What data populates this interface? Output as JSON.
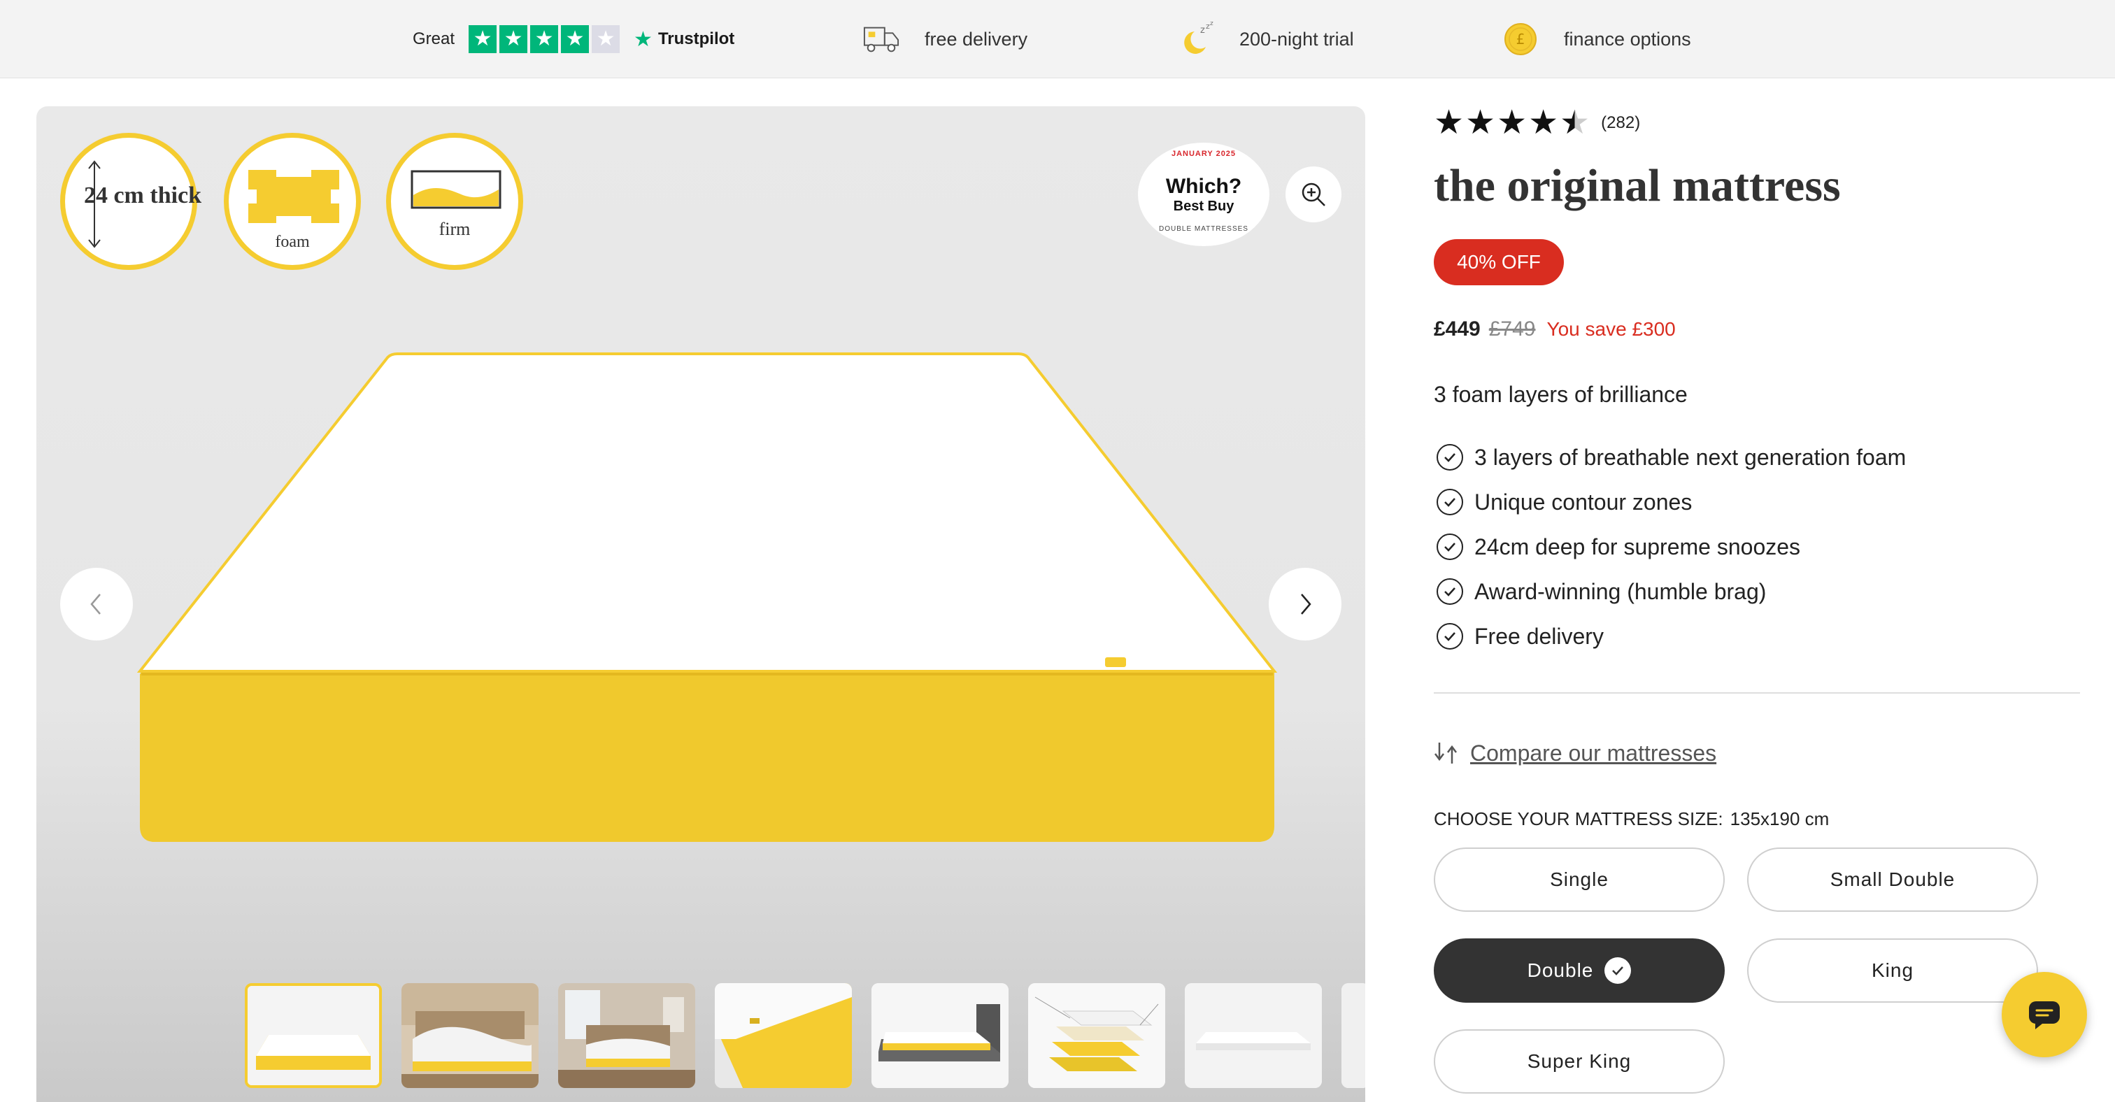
{
  "topbar": {
    "trustpilot": {
      "rating_word": "Great",
      "stars_filled": 4,
      "stars_total": 5,
      "brand": "Trustpilot"
    },
    "usps": [
      {
        "icon": "delivery-truck-icon",
        "label": "free delivery"
      },
      {
        "icon": "moon-sleep-icon",
        "label": "200-night trial"
      },
      {
        "icon": "pound-coin-icon",
        "label": "finance options"
      }
    ]
  },
  "gallery": {
    "badges": [
      {
        "icon": "thickness-icon",
        "label": "24 cm thick"
      },
      {
        "icon": "foam-icon",
        "label": "foam"
      },
      {
        "icon": "firmness-icon",
        "label": "firm"
      }
    ],
    "award": {
      "top": "JANUARY 2025",
      "brand": "Which?",
      "name": "Best Buy",
      "bottom": "DOUBLE MATTRESSES"
    },
    "thumbnails": [
      "mattress",
      "bedroom-duvet",
      "bedroom-window",
      "mattress-corner",
      "grey-bed-frame",
      "layers-diagram",
      "mattress-white",
      "partial"
    ],
    "selected_thumbnail": 0
  },
  "product": {
    "rating": 4.5,
    "reviews": "(282)",
    "title": "the original mattress",
    "discount": "40% OFF",
    "price": "£449",
    "was_price": "£749",
    "saving": "You save £300",
    "tagline": "3 foam layers of brilliance",
    "features": [
      "3 layers of breathable next generation foam",
      "Unique contour zones",
      "24cm deep for supreme snoozes",
      "Award-winning (humble brag)",
      "Free delivery"
    ],
    "compare_link": "Compare our mattresses",
    "size_label": "CHOOSE YOUR MATTRESS SIZE:",
    "size_value": "135x190 cm",
    "sizes": [
      "Single",
      "Small Double",
      "Double",
      "King",
      "Super King"
    ],
    "selected_size": "Double"
  },
  "colors": {
    "brand_yellow": "#f5cc30",
    "sale_red": "#d92d20",
    "trustpilot_green": "#00b67a",
    "selected_dark": "#333333"
  }
}
